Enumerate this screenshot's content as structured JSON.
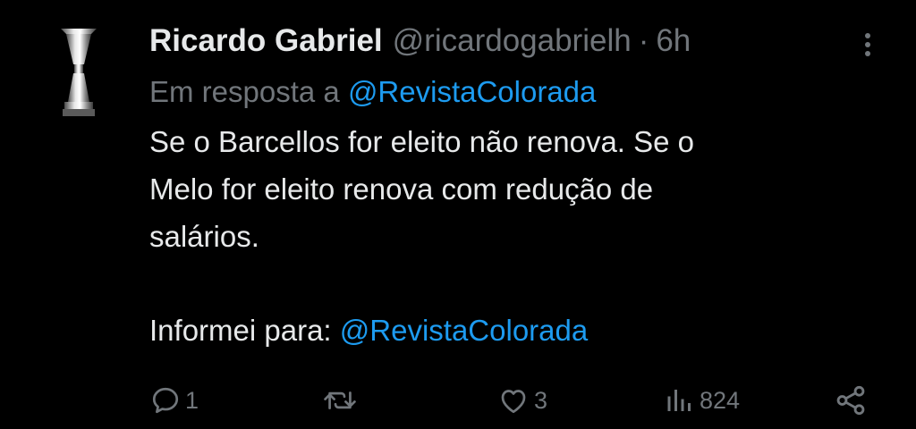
{
  "tweet": {
    "author_name": "Ricardo Gabriel",
    "handle": "@ricardogabrielh",
    "separator": "·",
    "time": "6h",
    "reply_prefix": "Em resposta a",
    "reply_mention": "@RevistaColorada",
    "text_main": "Se o Barcellos for eleito não renova. Se o\nMelo for eleito renova com redução de\nsalários.",
    "text_info_prefix": "Informei para:",
    "text_info_mention": "@RevistaColorada"
  },
  "actions": {
    "replies": "1",
    "retweets": "",
    "likes": "3",
    "views": "824"
  },
  "icons": {
    "avatar": "trophy-avatar",
    "more": "more-vertical-icon",
    "reply": "reply-icon",
    "retweet": "retweet-icon",
    "like": "heart-icon",
    "views": "views-icon",
    "share": "share-icon"
  },
  "colors": {
    "background": "#000000",
    "text": "#e7e9ea",
    "secondary": "#71767b",
    "link": "#1d9bf0"
  }
}
